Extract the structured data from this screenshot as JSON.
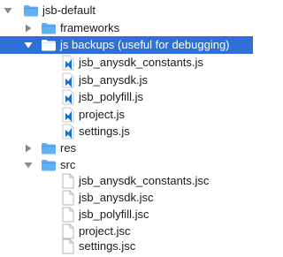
{
  "tree": {
    "root": {
      "label": "jsb-default",
      "icon": "folder-icon",
      "expanded": true
    },
    "frameworks": {
      "label": "frameworks",
      "icon": "folder-icon",
      "expanded": false
    },
    "js_backups": {
      "label": "js backups (useful for debugging)",
      "icon": "folder-icon",
      "expanded": true,
      "selected": true,
      "files": [
        {
          "label": "jsb_anysdk_constants.js",
          "icon": "vscode-file-icon"
        },
        {
          "label": "jsb_anysdk.js",
          "icon": "vscode-file-icon"
        },
        {
          "label": "jsb_polyfill.js",
          "icon": "vscode-file-icon"
        },
        {
          "label": "project.js",
          "icon": "vscode-file-icon"
        },
        {
          "label": "settings.js",
          "icon": "vscode-file-icon"
        }
      ]
    },
    "res": {
      "label": "res",
      "icon": "folder-icon",
      "expanded": false
    },
    "src": {
      "label": "src",
      "icon": "folder-icon",
      "expanded": true,
      "files": [
        {
          "label": "jsb_anysdk_constants.jsc",
          "icon": "blank-file-icon"
        },
        {
          "label": "jsb_anysdk.jsc",
          "icon": "blank-file-icon"
        },
        {
          "label": "jsb_polyfill.jsc",
          "icon": "blank-file-icon"
        },
        {
          "label": "project.jsc",
          "icon": "blank-file-icon"
        },
        {
          "label": "settings.jsc",
          "icon": "blank-file-icon"
        }
      ]
    }
  },
  "colors": {
    "selection": "#2f6fd8",
    "folder": "#62b0f3",
    "arrow": "#8a8a8a",
    "vscode": "#1f6fc5"
  }
}
